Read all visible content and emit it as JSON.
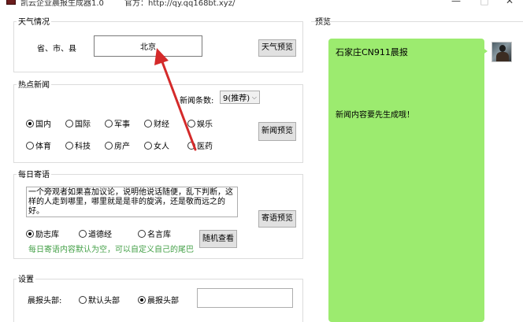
{
  "window": {
    "title": "凯云企业晨报生成器1.0",
    "site": "官方：http://qy.qq168bt.xyz/",
    "minimize": "—",
    "maximize": "□",
    "close": "✕"
  },
  "weather": {
    "group_title": "天气情况",
    "region_label": "省、市、县",
    "city_value": "北京",
    "preview_button": "天气预览"
  },
  "news": {
    "group_title": "热点新闻",
    "count_label": "新闻条数:",
    "count_value": "9(推荐)",
    "categories": [
      {
        "label": "国内",
        "selected": true
      },
      {
        "label": "国际",
        "selected": false
      },
      {
        "label": "军事",
        "selected": false
      },
      {
        "label": "财经",
        "selected": false
      },
      {
        "label": "娱乐",
        "selected": false
      },
      {
        "label": "体育",
        "selected": false
      },
      {
        "label": "科技",
        "selected": false
      },
      {
        "label": "房产",
        "selected": false
      },
      {
        "label": "女人",
        "selected": false
      },
      {
        "label": "医药",
        "selected": false
      }
    ],
    "preview_button": "新闻预览"
  },
  "quote": {
    "group_title": "每日寄语",
    "text": "一个旁观者如果喜加议论，说明他说话随便，乱下判断，这样的人走到哪里，哪里就是是非的旋涡，还是敬而远之的好。",
    "options": [
      {
        "label": "励志库",
        "selected": true
      },
      {
        "label": "道德经",
        "selected": false
      },
      {
        "label": "名言库",
        "selected": false
      }
    ],
    "random_button": "随机查看",
    "preview_button": "寄语预览",
    "hint": "每日寄语内容默认为空，可以自定义自己的尾巴"
  },
  "settings": {
    "group_title": "设置",
    "header_label": "晨报头部:",
    "options": [
      {
        "label": "默认头部",
        "selected": false
      },
      {
        "label": "晨报头部",
        "selected": true
      }
    ],
    "header_text": ""
  },
  "preview": {
    "group_title": "预览",
    "title_line": "石家庄CN911晨报",
    "body_line": "新闻内容要先生成哦！",
    "bubble_color": "#9ceb6f"
  },
  "annotation": {
    "arrow_color": "#d42a2a"
  }
}
